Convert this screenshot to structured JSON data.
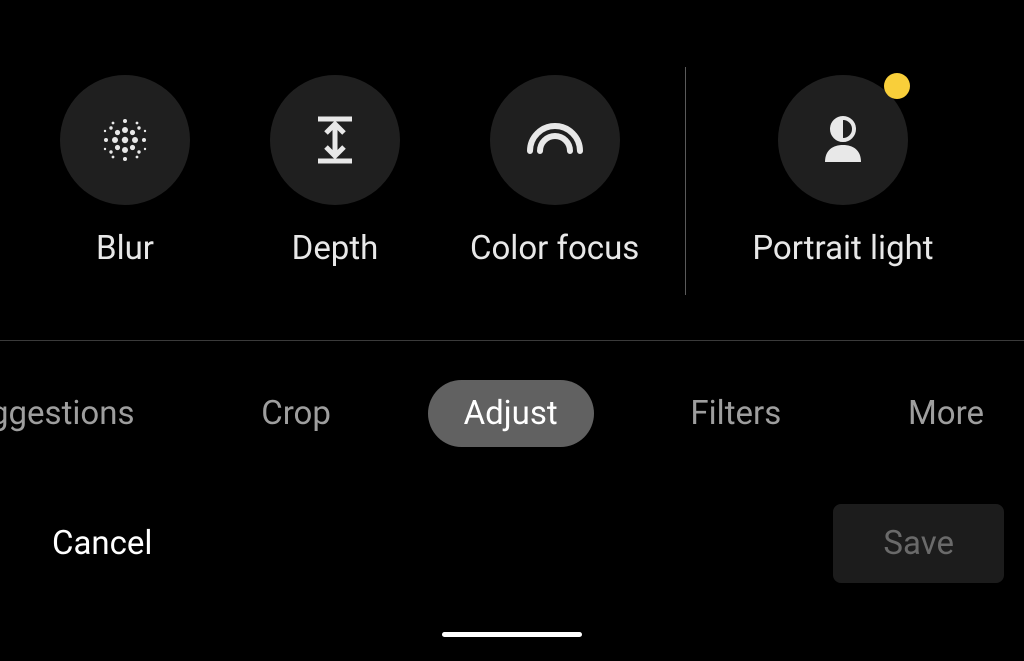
{
  "tools": {
    "blur": {
      "label": "Blur"
    },
    "depth": {
      "label": "Depth"
    },
    "color_focus": {
      "label": "Color focus"
    },
    "portrait_light": {
      "label": "Portrait light",
      "has_badge": true
    }
  },
  "tabs": {
    "suggestions": {
      "label": "ggestions"
    },
    "crop": {
      "label": "Crop"
    },
    "adjust": {
      "label": "Adjust"
    },
    "filters": {
      "label": "Filters"
    },
    "more": {
      "label": "More"
    },
    "active": "adjust"
  },
  "actions": {
    "cancel": {
      "label": "Cancel"
    },
    "save": {
      "label": "Save"
    }
  }
}
